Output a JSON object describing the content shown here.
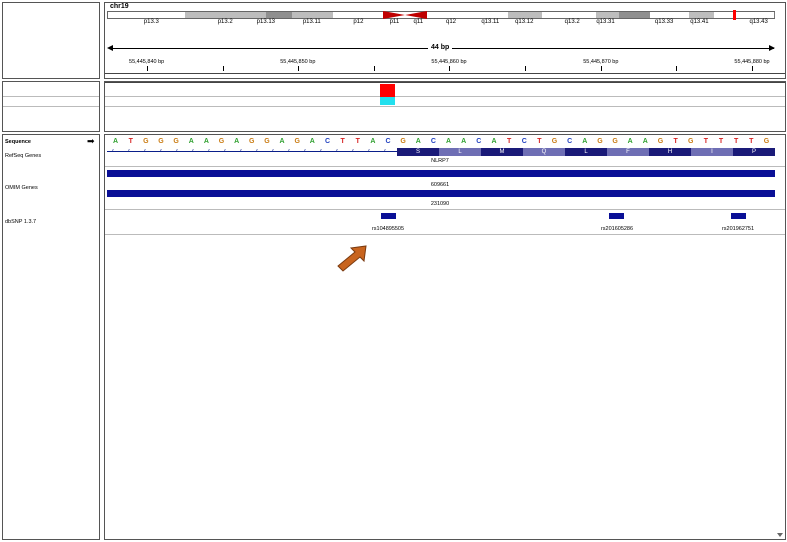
{
  "header": {
    "chromosome": "chr19",
    "span": "44 bp",
    "bands": [
      {
        "label": "p13.3",
        "start": 0.0,
        "end": 0.116,
        "fill": "#ffffff",
        "label_pos": 0.065
      },
      {
        "label": "p13.2",
        "start": 0.116,
        "end": 0.237,
        "fill": "#bdbdbd",
        "label_pos": 0.176
      },
      {
        "label": "p13.13",
        "start": 0.237,
        "end": 0.276,
        "fill": "#ffffff",
        "label_pos": 0.237
      },
      {
        "label": "",
        "start": 0.237,
        "end": 0.276,
        "fill": "#8f8f8f",
        "label_pos": 0.0
      },
      {
        "label": "p13.11",
        "start": 0.276,
        "end": 0.338,
        "fill": "#bdbdbd",
        "label_pos": 0.306
      },
      {
        "label": "p12",
        "start": 0.338,
        "end": 0.414,
        "fill": "#ffffff",
        "label_pos": 0.376
      },
      {
        "label": "p11",
        "start": 0.414,
        "end": 0.448,
        "fill": "#ffffff",
        "label_pos": 0.43
      },
      {
        "label": "q11",
        "start": 0.448,
        "end": 0.484,
        "fill": "#ffffff",
        "label_pos": 0.466
      },
      {
        "label": "q12",
        "start": 0.484,
        "end": 0.556,
        "fill": "#ffffff",
        "label_pos": 0.515
      },
      {
        "label": "q13.11",
        "start": 0.556,
        "end": 0.6,
        "fill": "#ffffff",
        "label_pos": 0.574
      },
      {
        "label": "q13.12",
        "start": 0.6,
        "end": 0.652,
        "fill": "#bdbdbd",
        "label_pos": 0.625
      },
      {
        "label": "q13.2",
        "start": 0.652,
        "end": 0.733,
        "fill": "#ffffff",
        "label_pos": 0.697
      },
      {
        "label": "q13.31",
        "start": 0.733,
        "end": 0.768,
        "fill": "#bdbdbd",
        "label_pos": 0.747
      },
      {
        "label": "",
        "start": 0.768,
        "end": 0.814,
        "fill": "#8f8f8f",
        "label_pos": 0.0
      },
      {
        "label": "q13.33",
        "start": 0.814,
        "end": 0.872,
        "fill": "#ffffff",
        "label_pos": 0.835
      },
      {
        "label": "q13.41",
        "start": 0.872,
        "end": 0.91,
        "fill": "#bdbdbd",
        "label_pos": 0.888
      },
      {
        "label": "q13.43",
        "start": 0.91,
        "end": 1.0,
        "fill": "#ffffff",
        "label_pos": 0.977
      }
    ],
    "ticks": [
      {
        "label": "55,445,840 bp",
        "pos": 0.058
      },
      {
        "label": "55,445,850 bp",
        "pos": 0.285
      },
      {
        "label": "55,445,860 bp",
        "pos": 0.512
      },
      {
        "label": "55,445,870 bp",
        "pos": 0.74
      },
      {
        "label": "55,445,880 bp",
        "pos": 0.967
      }
    ],
    "minor_ticks": [
      0.172,
      0.399,
      0.626,
      0.853
    ]
  },
  "tracks": {
    "sequence_label": "Sequence",
    "refseq_label": "RefSeq Genes",
    "omim_label": "OMIM Genes",
    "dbsnp_label": "dbSNP 1.3.7"
  },
  "sequence": {
    "bases": [
      "A",
      "T",
      "G",
      "G",
      "G",
      "A",
      "A",
      "G",
      "A",
      "G",
      "G",
      "A",
      "G",
      "A",
      "C",
      "T",
      "T",
      "A",
      "C",
      "G",
      "A",
      "C",
      "A",
      "A",
      "C",
      "A",
      "T",
      "C",
      "T",
      "G",
      "C",
      "A",
      "G",
      "G",
      "A",
      "A",
      "G",
      "T",
      "G",
      "T",
      "T",
      "T",
      "T",
      "G"
    ],
    "colors": {
      "A": "#2fa02f",
      "T": "#d62020",
      "G": "#c97a10",
      "C": "#1f3fbf"
    }
  },
  "refseq": {
    "gene": "NLRP7",
    "amino_acids": [
      "S",
      "L",
      "M",
      "Q",
      "L",
      "F",
      "H",
      "I",
      "P"
    ]
  },
  "omim": {
    "ids": [
      "609661",
      "231090"
    ]
  },
  "dbsnp": {
    "snps": [
      "rs104895505",
      "rs201605286",
      "rs201962751"
    ]
  }
}
